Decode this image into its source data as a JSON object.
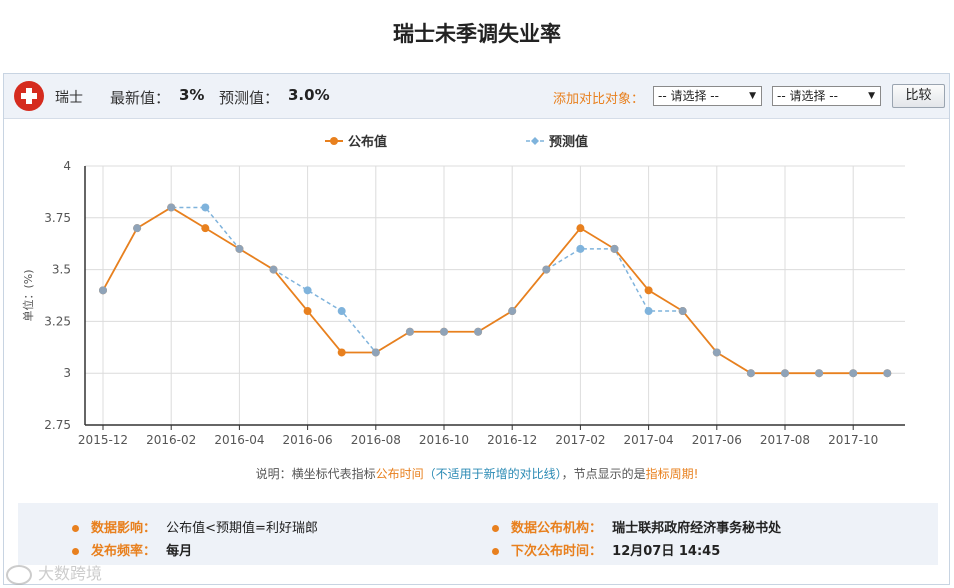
{
  "page": {
    "title": "瑞士未季调失业率"
  },
  "header": {
    "country": "瑞士",
    "latest_label": "最新值：",
    "latest_value": "3%",
    "forecast_label": "预测值：",
    "forecast_value": "3.0%",
    "compare_label": "添加对比对象：",
    "select_1": "-- 请选择 --",
    "select_2": "-- 请选择 --",
    "compare_button": "比较",
    "flag_color": "#d52b1e"
  },
  "chart_data": {
    "type": "line",
    "ylabel": "单位：(%)",
    "ylim": [
      2.75,
      4
    ],
    "yticks": [
      "2.75",
      "3",
      "3.25",
      "3.5",
      "3.75",
      "4"
    ],
    "xticks": [
      "2015-12",
      "2016-02",
      "2016-04",
      "2016-06",
      "2016-08",
      "2016-10",
      "2016-12",
      "2017-02",
      "2017-04",
      "2017-06",
      "2017-08",
      "2017-10"
    ],
    "x": [
      "2015-12",
      "2016-01",
      "2016-02",
      "2016-03",
      "2016-04",
      "2016-05",
      "2016-06",
      "2016-07",
      "2016-08",
      "2016-09",
      "2016-10",
      "2016-11",
      "2016-12",
      "2017-01",
      "2017-02",
      "2017-03",
      "2017-04",
      "2017-05",
      "2017-06",
      "2017-07",
      "2017-08",
      "2017-09",
      "2017-10",
      "2017-11"
    ],
    "series": [
      {
        "name": "公布值",
        "color": "#e8801e",
        "dashed": false,
        "values": [
          3.4,
          3.7,
          3.8,
          3.7,
          3.6,
          3.5,
          3.3,
          3.1,
          3.1,
          3.2,
          3.2,
          3.2,
          3.3,
          3.5,
          3.7,
          3.6,
          3.4,
          3.3,
          3.1,
          3.0,
          3.0,
          3.0,
          3.0,
          3.0
        ]
      },
      {
        "name": "预测值",
        "color": "#7fb3dc",
        "dashed": true,
        "values": [
          3.4,
          3.7,
          3.8,
          3.8,
          3.6,
          3.5,
          3.4,
          3.3,
          3.1,
          3.2,
          3.2,
          3.2,
          3.3,
          3.5,
          3.6,
          3.6,
          3.3,
          3.3,
          3.1,
          3.0,
          3.0,
          3.0,
          3.0,
          3.0
        ]
      }
    ],
    "legend_position": "top-center",
    "grid": true
  },
  "note": {
    "prefix": "说明：横坐标代表指标",
    "highlight1": "公布时间",
    "paren": "（不适用于新增的对比线）",
    "middle": "，节点显示的是",
    "highlight2": "指标周期!"
  },
  "info": {
    "impact_label": "数据影响：",
    "impact_value": "公布值<预期值=利好瑞郎",
    "frequency_label": "发布频率：",
    "frequency_value": "每月",
    "agency_label": "数据公布机构：",
    "agency_value": "瑞士联邦政府经济事务秘书处",
    "next_label": "下次公布时间：",
    "next_value": "12月07日 14:45",
    "accent_color": "#e8801e"
  },
  "watermark": {
    "text": "大数跨境"
  }
}
